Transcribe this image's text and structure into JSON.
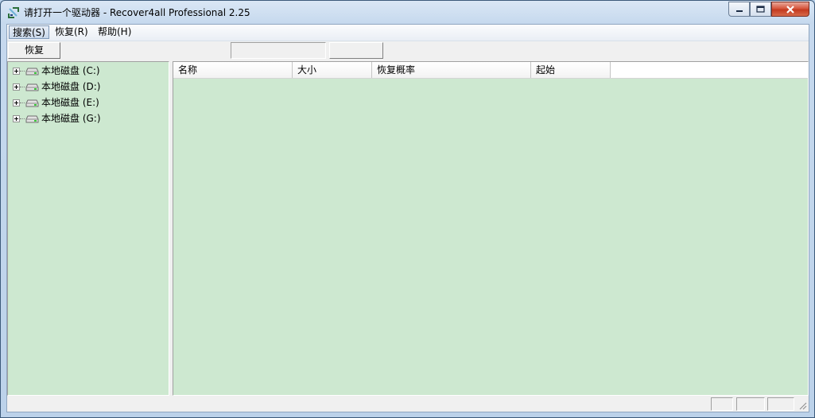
{
  "window": {
    "title": "请打开一个驱动器 - Recover4all Professional 2.25",
    "icons": {
      "app": "recover4all-app-icon",
      "minimize": "minimize-icon",
      "maximize": "maximize-icon",
      "close": "close-icon"
    }
  },
  "menubar": {
    "items": [
      {
        "label": "搜索(S)",
        "active": true
      },
      {
        "label": "恢复(R)"
      },
      {
        "label": "帮助(H)"
      }
    ]
  },
  "toolbar": {
    "restore_label": "恢复",
    "field_value": ""
  },
  "tree": {
    "items": [
      {
        "label": "本地磁盘 (C:)",
        "icon": "drive-icon"
      },
      {
        "label": "本地磁盘 (D:)",
        "icon": "drive-icon"
      },
      {
        "label": "本地磁盘 (E:)",
        "icon": "drive-icon"
      },
      {
        "label": "本地磁盘 (G:)",
        "icon": "drive-icon"
      }
    ]
  },
  "list": {
    "columns": [
      "名称",
      "大小",
      "恢复概率",
      "起始"
    ],
    "rows": []
  },
  "statusbar": {
    "panels": [
      "",
      "",
      ""
    ]
  },
  "colors": {
    "pane_background": "#cde8d0",
    "chrome": "#f0f0f0",
    "close_button": "#c33a1f"
  }
}
